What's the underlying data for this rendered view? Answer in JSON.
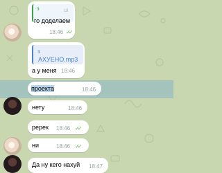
{
  "colors": {
    "background": "#c9d7b1",
    "bubble": "#ffffff",
    "selection": "#78aacd",
    "time": "#9aa4a4",
    "checks": "#4fae4e",
    "reply_accent": "#3aa346",
    "file_accent": "#4a84c6"
  },
  "messages": [
    {
      "reply_author": "з",
      "reply_sub": "ш",
      "text": "го доделаем",
      "time": "18:46",
      "checks": "✓✓"
    },
    {
      "file_author": "з",
      "file_name": "АХУЕНО.mp3",
      "text": "а у меня",
      "time": "18:46"
    },
    {
      "text": "проекта",
      "time": "18:46",
      "selected": true
    },
    {
      "text": "нету",
      "time": "18:46"
    },
    {
      "text": "ререк",
      "time": "18:46",
      "checks": "✓✓"
    },
    {
      "text": "ни",
      "time": "18:46",
      "checks": "✓✓"
    },
    {
      "text": "Да ну кего нахуй",
      "time": "18:47"
    }
  ],
  "icons": {
    "avatar_1": "flower-avatar-icon",
    "avatar_2": "dark-avatar-icon",
    "read_receipt": "double-check-icon",
    "wallpaper": "doodle-pattern"
  }
}
